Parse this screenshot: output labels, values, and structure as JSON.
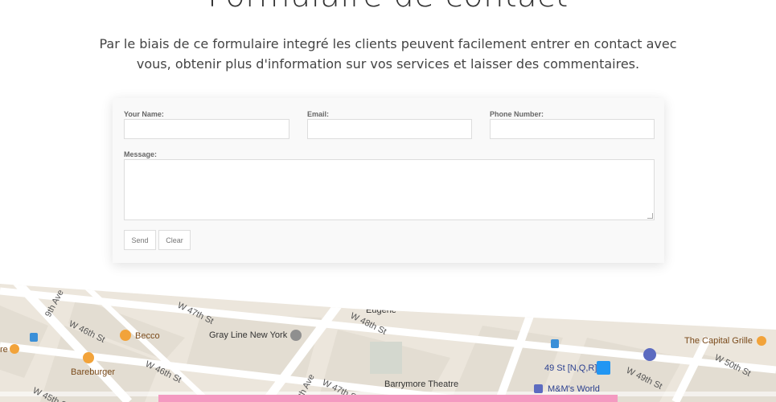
{
  "header": {
    "title": "Formulaire de contact",
    "intro_line1": "Par le biais de ce formulaire integré les clients peuvent facilement entrer en contact avec",
    "intro_line2": "vous, obtenir plus d'information sur vos services et laisser des commentaires."
  },
  "form": {
    "name_label": "Your Name:",
    "name_value": "",
    "email_label": "Email:",
    "email_value": "",
    "phone_label": "Phone Number:",
    "phone_value": "",
    "message_label": "Message:",
    "message_value": "",
    "send_label": "Send",
    "clear_label": "Clear"
  },
  "map": {
    "streets": [
      "W 47th St",
      "W 46th St",
      "W 46th St",
      "W 45th St",
      "W 47th St",
      "W 48th St",
      "W 49th St",
      "W 50th St",
      "9th Ave",
      "8th Ave"
    ],
    "places": {
      "becco": "Becco",
      "bareburger": "Bareburger",
      "gray_line": "Gray Line New York",
      "eugene": "Eugene",
      "barrymore": "Barrymore Theatre",
      "subway": "49 St [N,Q,R]",
      "mms": "M&M's World",
      "capital_grille": "The Capital Grille",
      "left_edge": "re"
    },
    "colors": {
      "land": "#ece6dc",
      "block": "#e3ddd2",
      "road": "#ffffff",
      "overlay": "#f49ac1"
    }
  }
}
